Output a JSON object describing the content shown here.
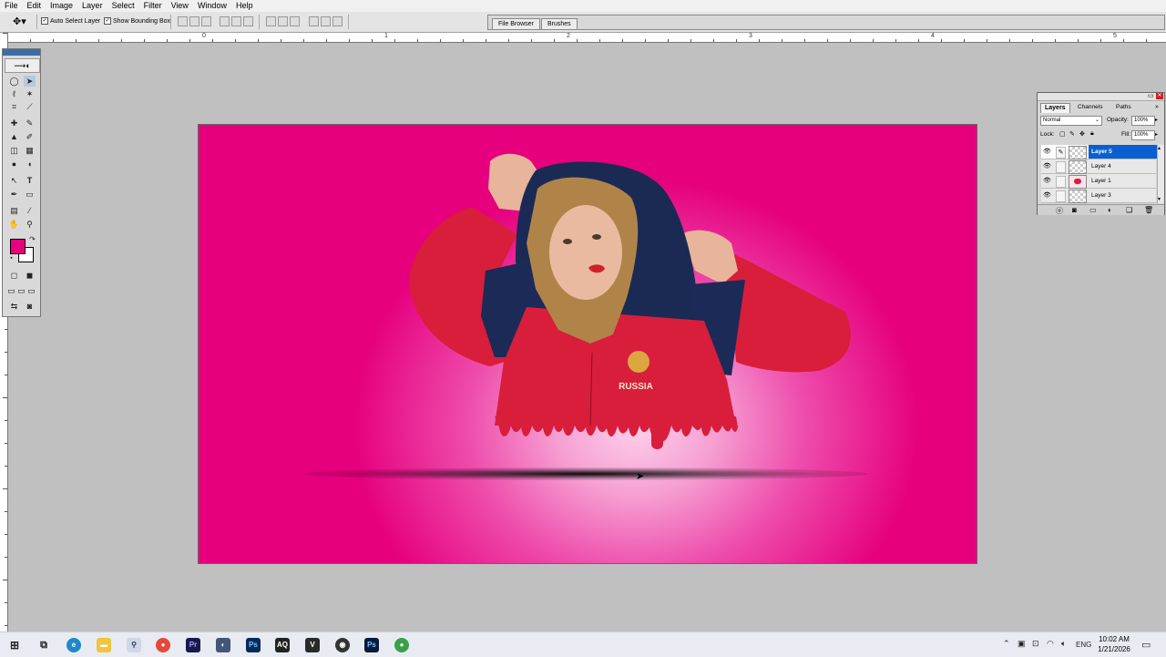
{
  "menubar": {
    "items": [
      "File",
      "Edit",
      "Image",
      "Layer",
      "Select",
      "Filter",
      "View",
      "Window",
      "Help"
    ]
  },
  "options": {
    "auto_select_layer": "Auto Select Layer",
    "show_bounding_box": "Show Bounding Box"
  },
  "palette_well": {
    "tabs": [
      "File Browser",
      "Brushes"
    ]
  },
  "ruler": {
    "numbers": [
      "0",
      "1",
      "2",
      "3",
      "4",
      "5"
    ]
  },
  "toolbox": {
    "foreground_color": "#e6007e",
    "background_color": "#ffffff"
  },
  "canvas": {
    "colors": {
      "edge": "#e6007e",
      "center": "#fdd0ea"
    },
    "chest_text": "RUSSIA"
  },
  "layers_panel": {
    "tabs": [
      "Layers",
      "Channels",
      "Paths"
    ],
    "blend_mode": "Normal",
    "opacity_label": "Opacity:",
    "opacity_value": "100%",
    "lock_label": "Lock:",
    "fill_label": "Fill:",
    "fill_value": "100%",
    "layers": [
      {
        "name": "Layer 5",
        "selected": true
      },
      {
        "name": "Layer 4",
        "selected": false
      },
      {
        "name": "Layer 1",
        "selected": false
      },
      {
        "name": "Layer 3",
        "selected": false
      }
    ]
  },
  "taskbar": {
    "language": "ENG",
    "time": "10:02 AM",
    "date": "1/21/2026",
    "apps": [
      "start-icon",
      "task-view-icon",
      "edge-icon",
      "file-explorer-icon",
      "magnifier-icon",
      "chrome-icon",
      "premiere-icon",
      "app-icon",
      "photoshop-icon",
      "aq-icon",
      "vegas-icon",
      "davinci-icon",
      "photoshop-alt-icon",
      "chrome-alt-icon"
    ]
  }
}
